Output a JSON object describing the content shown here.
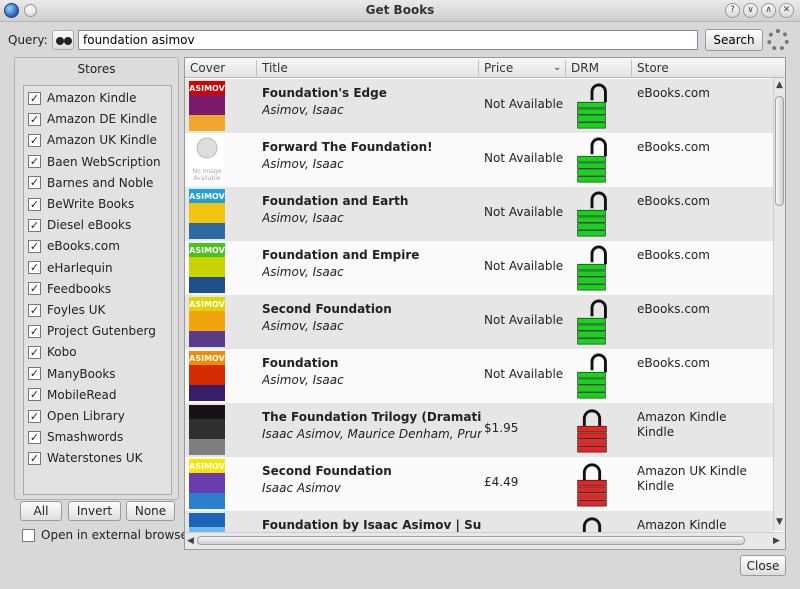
{
  "window": {
    "title": "Get Books"
  },
  "query": {
    "label": "Query:",
    "value": "foundation asimov",
    "search_label": "Search"
  },
  "stores_panel": {
    "title": "Stores",
    "items": [
      {
        "label": "Amazon Kindle"
      },
      {
        "label": "Amazon DE Kindle"
      },
      {
        "label": "Amazon UK Kindle"
      },
      {
        "label": "Baen WebScription"
      },
      {
        "label": "Barnes and Noble"
      },
      {
        "label": "BeWrite Books"
      },
      {
        "label": "Diesel eBooks"
      },
      {
        "label": "eBooks.com"
      },
      {
        "label": "eHarlequin"
      },
      {
        "label": "Feedbooks"
      },
      {
        "label": "Foyles UK"
      },
      {
        "label": "Project Gutenberg"
      },
      {
        "label": "Kobo"
      },
      {
        "label": "ManyBooks"
      },
      {
        "label": "MobileRead"
      },
      {
        "label": "Open Library"
      },
      {
        "label": "Smashwords"
      },
      {
        "label": "Waterstones UK"
      }
    ],
    "check_mark": "✓",
    "buttons": {
      "all": "All",
      "invert": "Invert",
      "none": "None"
    },
    "open_external": "Open in external browser"
  },
  "results": {
    "columns": {
      "cover": "Cover",
      "title": "Title",
      "price": "Price",
      "drm": "DRM",
      "store": "Store"
    },
    "rows": [
      {
        "title": "Foundation's Edge",
        "author": "Asimov, Isaac",
        "price": "Not Available",
        "drm": "open",
        "store_line1": "eBooks.com",
        "store_line2": ""
      },
      {
        "title": "Forward The Foundation!",
        "author": "Asimov, Isaac",
        "price": "Not Available",
        "drm": "open",
        "store_line1": "eBooks.com",
        "store_line2": ""
      },
      {
        "title": "Foundation and Earth",
        "author": "Asimov, Isaac",
        "price": "Not Available",
        "drm": "open",
        "store_line1": "eBooks.com",
        "store_line2": ""
      },
      {
        "title": "Foundation and Empire",
        "author": "Asimov, Isaac",
        "price": "Not Available",
        "drm": "open",
        "store_line1": "eBooks.com",
        "store_line2": ""
      },
      {
        "title": "Second Foundation",
        "author": "Asimov, Isaac",
        "price": "Not Available",
        "drm": "open",
        "store_line1": "eBooks.com",
        "store_line2": ""
      },
      {
        "title": "Foundation",
        "author": "Asimov, Isaac",
        "price": "Not Available",
        "drm": "open",
        "store_line1": "eBooks.com",
        "store_line2": ""
      },
      {
        "title": "The Foundation Trilogy (Dramatized)",
        "author": "Isaac Asimov, Maurice Denham, Prunella Sc",
        "price": "$1.95",
        "drm": "locked",
        "store_line1": "Amazon Kindle",
        "store_line2": "Kindle"
      },
      {
        "title": "Second Foundation",
        "author": "Isaac Asimov",
        "price": "£4.49",
        "drm": "locked",
        "store_line1": "Amazon UK Kindle",
        "store_line2": "Kindle"
      },
      {
        "title": "Foundation by Isaac Asimov | Summary &",
        "author": "",
        "price": "",
        "drm": "locked",
        "store_line1": "Amazon Kindle",
        "store_line2": "Kindle"
      }
    ],
    "cover_text": "ASIMOV",
    "no_image_text": "No Image Available"
  },
  "footer": {
    "close_label": "Close"
  },
  "colors": {
    "drm_open": "#19d21e",
    "drm_locked": "#e32626",
    "row_alt": "#e6e6e6",
    "accent": "#1e5fb0"
  }
}
